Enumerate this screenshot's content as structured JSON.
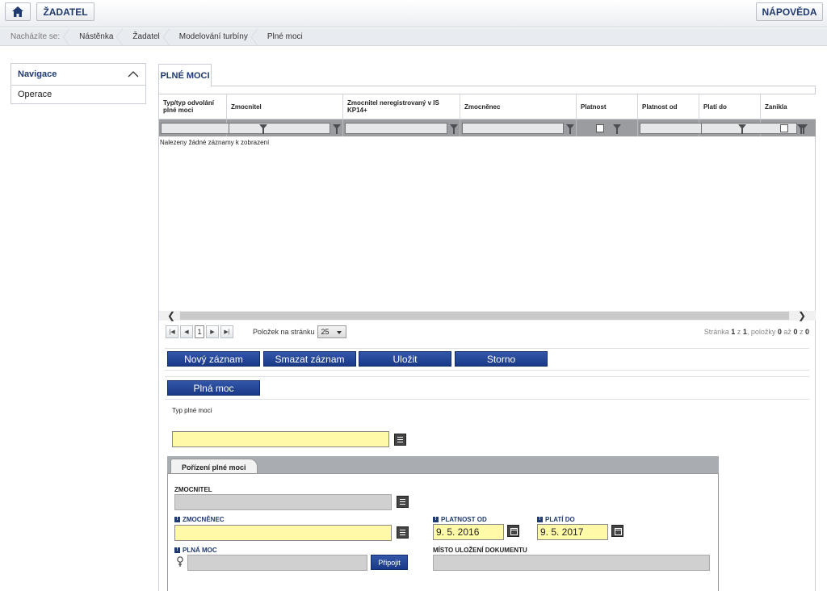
{
  "topbar": {
    "home_icon": "home-icon",
    "zadatel_label": "ŽADATEL",
    "help_label": "NÁPOVĚDA"
  },
  "breadcrumb": {
    "lead": "Nacházíte se:",
    "items": [
      "Nástěnka",
      "Žadatel",
      "Modelování turbíny",
      "Plné moci"
    ]
  },
  "nav": {
    "title": "Navigace",
    "items": [
      "Operace"
    ]
  },
  "main": {
    "tab_label": "PLNÉ MOCI",
    "grid": {
      "columns": [
        "Typ/typ odvolání plné moci",
        "Zmocnitel",
        "Zmocnitel neregistrovaný v IS KP14+",
        "Zmocněnec",
        "Platnost",
        "Platnost od",
        "Platí do",
        "Zanikla"
      ],
      "no_records": "Nalezeny žádné záznamy k zobrazení"
    },
    "pager": {
      "current_page": "1",
      "page_size_label": "Položek na stránku",
      "page_size": "25",
      "info_prefix": "Stránka",
      "info_page": "1",
      "info_of": "z",
      "info_pages": "1",
      "info_items": ", položky",
      "info_from": "0",
      "info_to_word": "až",
      "info_to": "0",
      "info_of2": "z",
      "info_total": "0"
    },
    "actions": {
      "new": "Nový záznam",
      "delete": "Smazat záznam",
      "save": "Uložit",
      "cancel": "Storno"
    },
    "section_button": "Plná moc",
    "form": {
      "type_label": "Typ plné moci",
      "type_value": "",
      "subtab": "Pořízení plné moci",
      "zmocnitel_label": "ZMOCNITEL",
      "zmocnenec_label": "ZMOCNĚNEC",
      "platnost_od_label": "PLATNOST OD",
      "platnost_od_value": "9. 5. 2016",
      "plati_do_label": "PLATÍ DO",
      "plati_do_value": "9. 5. 2017",
      "plna_moc_label": "PLNÁ MOC",
      "connect_label": "Připojit",
      "misto_label": "MÍSTO ULOŽENÍ DOKUMENTU"
    }
  },
  "colors": {
    "accent": "#1f3a6e",
    "button": "#1a3a88",
    "required_field": "#fff9a8"
  }
}
